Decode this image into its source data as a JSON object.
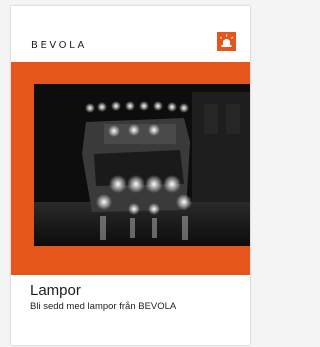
{
  "brand": {
    "logo_text": "BEVOLA",
    "accent_color": "#e4561b",
    "icon": "warning-beacon-icon"
  },
  "cover": {
    "title": "Lampor",
    "subtitle": "Bli sedd med lampor från BEVOLA",
    "photo": "truck-with-lights-at-night-photo"
  }
}
